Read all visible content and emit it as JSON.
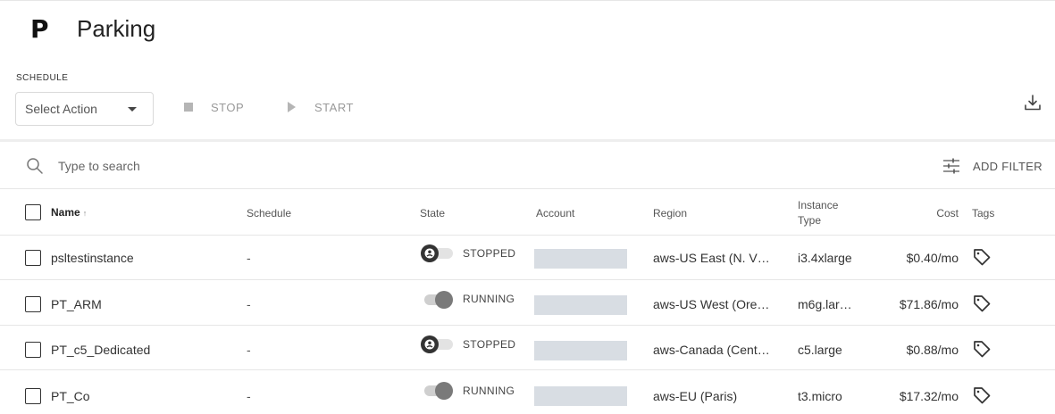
{
  "header": {
    "logo": "P",
    "title": "Parking"
  },
  "toolbar": {
    "schedule_label": "SCHEDULE",
    "select_action": "Select Action",
    "stop_label": "STOP",
    "start_label": "START"
  },
  "search": {
    "placeholder": "Type to search"
  },
  "filter": {
    "label": "ADD FILTER"
  },
  "columns": {
    "name": "Name",
    "sort_indicator": "↑",
    "schedule": "Schedule",
    "state": "State",
    "account": "Account",
    "region": "Region",
    "instance_type_line1": "Instance",
    "instance_type_line2": "Type",
    "cost": "Cost",
    "tags": "Tags"
  },
  "rows": [
    {
      "name": "psltestinstance",
      "schedule": "-",
      "state": "STOPPED",
      "region": "aws-US East (N. V…",
      "instance_type": "i3.4xlarge",
      "cost": "$0.40/mo"
    },
    {
      "name": "PT_ARM",
      "schedule": "-",
      "state": "RUNNING",
      "region": "aws-US West (Ore…",
      "instance_type": "m6g.lar…",
      "cost": "$71.86/mo"
    },
    {
      "name": "PT_c5_Dedicated",
      "schedule": "-",
      "state": "STOPPED",
      "region": "aws-Canada (Cent…",
      "instance_type": "c5.large",
      "cost": "$0.88/mo"
    },
    {
      "name": "PT_Co",
      "schedule": "-",
      "state": "RUNNING",
      "region": "aws-EU (Paris)",
      "instance_type": "t3.micro",
      "cost": "$17.32/mo"
    }
  ],
  "colors": {
    "toggle_stopped_knob": "#333333",
    "toggle_running_knob": "#7a7a7a",
    "account_redaction": "#d8dde3",
    "disabled_action": "#999999"
  },
  "icons": {
    "search": "search-icon",
    "filter": "filter-sliders-icon",
    "download": "download-icon",
    "tag": "tag-icon",
    "stop": "stop-icon",
    "start": "play-icon",
    "dropdown": "caret-down-icon"
  }
}
